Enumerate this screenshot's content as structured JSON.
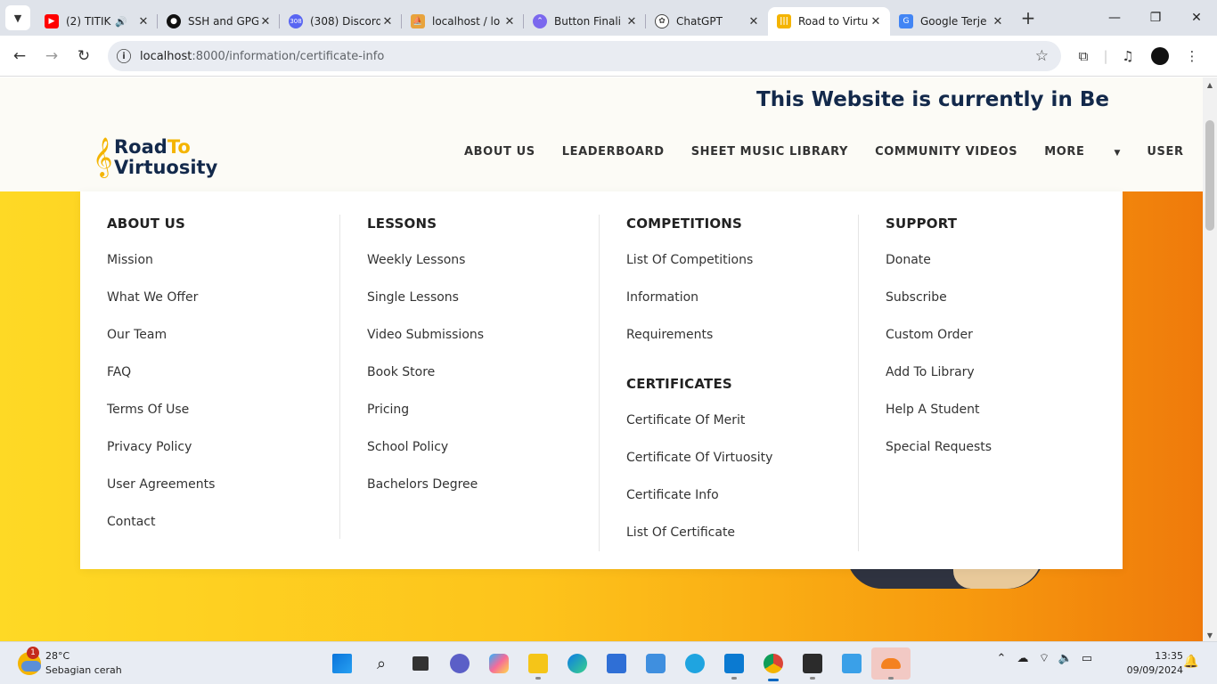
{
  "browser": {
    "tabs": [
      {
        "title": "(2) TITIK",
        "favicon": "youtube-icon",
        "color": "#ff0000",
        "audio": true
      },
      {
        "title": "SSH and GPG",
        "favicon": "github-icon",
        "color": "#111111"
      },
      {
        "title": "(308) Discord",
        "favicon": "discord-icon",
        "color": "#5865f2",
        "badge": "308"
      },
      {
        "title": "localhost / lo",
        "favicon": "phpmyadmin-icon",
        "color": "#e8a33d"
      },
      {
        "title": "Button Finali",
        "favicon": "clickup-icon",
        "color": "#7b68ee"
      },
      {
        "title": "ChatGPT",
        "favicon": "chatgpt-icon",
        "color": "#444444"
      },
      {
        "title": "Road to Virtu",
        "favicon": "road-to-virtuosity-icon",
        "color": "#f4b400",
        "active": true
      },
      {
        "title": "Google Terje",
        "favicon": "google-translate-icon",
        "color": "#4285f4"
      }
    ],
    "url_host": "localhost",
    "url_path": ":8000/information/certificate-info"
  },
  "page": {
    "beta_banner": "This Website is currently in Beta T",
    "logo_line1_a": "Road",
    "logo_line1_b": "To",
    "logo_line2": "Virtuosity",
    "nav": [
      "ABOUT US",
      "LEADERBOARD",
      "SHEET MUSIC LIBRARY",
      "COMMUNITY VIDEOS",
      "MORE",
      "USER"
    ]
  },
  "mega_menu": {
    "about": {
      "heading": "ABOUT US",
      "items": [
        "Mission",
        "What We Offer",
        "Our Team",
        "FAQ",
        "Terms Of Use",
        "Privacy Policy",
        "User Agreements",
        "Contact"
      ]
    },
    "lessons": {
      "heading": "LESSONS",
      "items": [
        "Weekly Lessons",
        "Single Lessons",
        "Video Submissions",
        "Book Store",
        "Pricing",
        "School Policy",
        "Bachelors Degree"
      ]
    },
    "competitions": {
      "heading": "COMPETITIONS",
      "items": [
        "List Of Competitions",
        "Information",
        "Requirements"
      ]
    },
    "certificates": {
      "heading": "CERTIFICATES",
      "items": [
        "Certificate Of Merit",
        "Certificate Of Virtuosity",
        "Certificate Info",
        "List Of Certificate"
      ]
    },
    "support": {
      "heading": "SUPPORT",
      "items": [
        "Donate",
        "Subscribe",
        "Custom Order",
        "Add To Library",
        "Help A Student",
        "Special Requests"
      ]
    }
  },
  "taskbar": {
    "weather_badge": "1",
    "temperature": "28°C",
    "condition": "Sebagian cerah",
    "time": "13:35",
    "date": "09/09/2024"
  }
}
